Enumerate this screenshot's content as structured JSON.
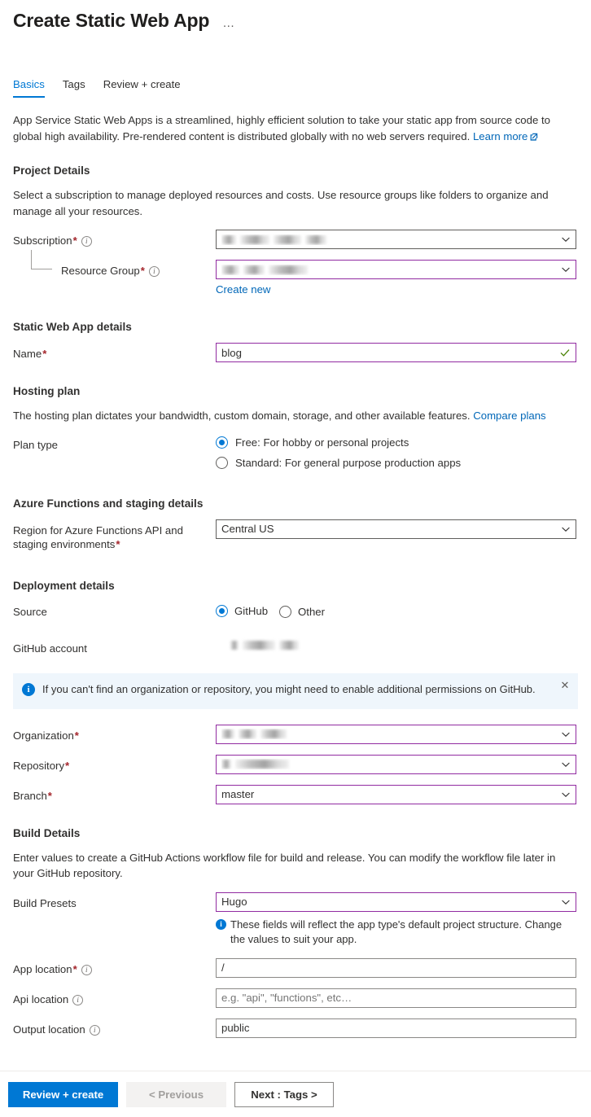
{
  "header": {
    "title": "Create Static Web App",
    "more_menu": "…"
  },
  "tabs": [
    {
      "label": "Basics",
      "active": true
    },
    {
      "label": "Tags",
      "active": false
    },
    {
      "label": "Review + create",
      "active": false
    }
  ],
  "intro": {
    "text": "App Service Static Web Apps is a streamlined, highly efficient solution to take your static app from source code to global high availability. Pre-rendered content is distributed globally with no web servers required.",
    "learn_more": "Learn more"
  },
  "project_details": {
    "heading": "Project Details",
    "description": "Select a subscription to manage deployed resources and costs. Use resource groups like folders to organize and manage all your resources.",
    "subscription": {
      "label": "Subscription",
      "required": true,
      "value": "",
      "redacted": true,
      "dirty": false
    },
    "resource_group": {
      "label": "Resource Group",
      "required": true,
      "value": "",
      "redacted": true,
      "dirty": true,
      "create_new": "Create new"
    }
  },
  "static_web_app_details": {
    "heading": "Static Web App details",
    "name": {
      "label": "Name",
      "required": true,
      "value": "blog",
      "valid": true,
      "dirty": true
    }
  },
  "hosting_plan": {
    "heading": "Hosting plan",
    "description": "The hosting plan dictates your bandwidth, custom domain, storage, and other available features.",
    "compare_link": "Compare plans",
    "plan_type_label": "Plan type",
    "options": [
      {
        "label": "Free: For hobby or personal projects",
        "selected": true
      },
      {
        "label": "Standard: For general purpose production apps",
        "selected": false
      }
    ]
  },
  "functions_staging": {
    "heading": "Azure Functions and staging details",
    "region": {
      "label": "Region for Azure Functions API and staging environments",
      "required": true,
      "value": "Central US",
      "dirty": false
    }
  },
  "deployment_details": {
    "heading": "Deployment details",
    "source": {
      "label": "Source",
      "options": [
        {
          "label": "GitHub",
          "selected": true
        },
        {
          "label": "Other",
          "selected": false
        }
      ]
    },
    "github_account": {
      "label": "GitHub account",
      "value": "",
      "redacted": true
    },
    "banner": {
      "icon": "info-icon",
      "text": "If you can't find an organization or repository, you might need to enable additional permissions on GitHub.",
      "close": "✕"
    },
    "organization": {
      "label": "Organization",
      "required": true,
      "value": "",
      "redacted": true,
      "dirty": true
    },
    "repository": {
      "label": "Repository",
      "required": true,
      "value": "",
      "redacted": true,
      "dirty": true
    },
    "branch": {
      "label": "Branch",
      "required": true,
      "value": "master",
      "dirty": true
    }
  },
  "build_details": {
    "heading": "Build Details",
    "description": "Enter values to create a GitHub Actions workflow file for build and release. You can modify the workflow file later in your GitHub repository.",
    "build_presets": {
      "label": "Build Presets",
      "value": "Hugo",
      "dirty": true
    },
    "preset_note": "These fields will reflect the app type's default project structure. Change the values to suit your app.",
    "app_location": {
      "label": "App location",
      "required": true,
      "value": "/",
      "dirty": false
    },
    "api_location": {
      "label": "Api location",
      "required": false,
      "value": "",
      "placeholder": "e.g. \"api\", \"functions\", etc…",
      "dirty": false
    },
    "output_location": {
      "label": "Output location",
      "required": false,
      "value": "public",
      "dirty": false
    }
  },
  "footer": {
    "review_create": "Review + create",
    "previous": "< Previous",
    "next": "Next : Tags >"
  },
  "colors": {
    "accent": "#0078d4",
    "link": "#0067b8",
    "required": "#a4262c",
    "dirty_border": "#912ba1",
    "valid_check": "#498205",
    "banner_bg": "#eff6fc"
  }
}
